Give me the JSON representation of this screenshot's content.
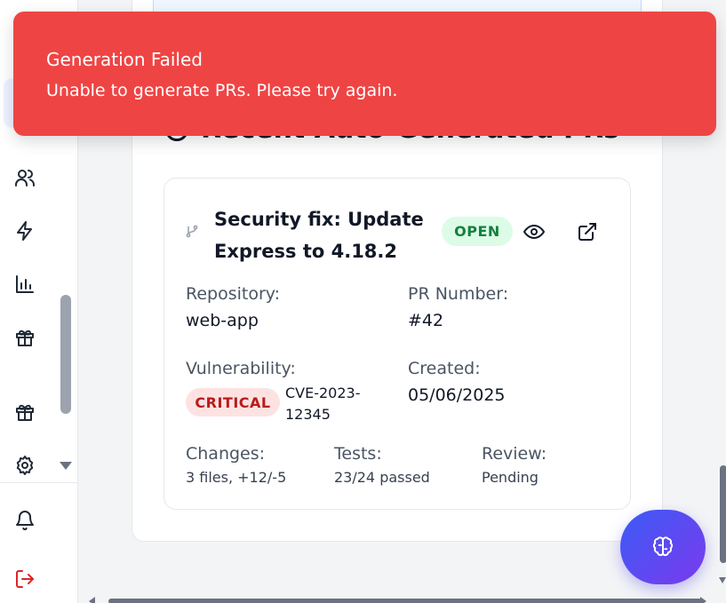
{
  "toast": {
    "title": "Generation Failed",
    "message": "Unable to generate PRs. Please try again.",
    "color": "#ef4444"
  },
  "section": {
    "title": "Recent Auto-Generated PRs",
    "icon": "clock-icon"
  },
  "pr": {
    "title": "Security fix: Update Express to 4.18.2",
    "status": "OPEN",
    "repository_label": "Repository:",
    "repository": "web-app",
    "pr_number_label": "PR Number:",
    "pr_number": "#42",
    "vulnerability_label": "Vulnerability:",
    "severity": "CRITICAL",
    "cve": "CVE-2023-12345",
    "created_label": "Created:",
    "created": "05/06/2025",
    "changes_label": "Changes:",
    "changes": "3 files, +12/-5",
    "tests_label": "Tests:",
    "tests": "23/24 passed",
    "review_label": "Review:",
    "review": "Pending",
    "icons": [
      "git-branch-icon",
      "eye-icon",
      "external-link-icon"
    ]
  },
  "sidebar": {
    "icons": [
      "users-icon",
      "lightning-icon",
      "bar-chart-icon",
      "gift-icon",
      "gift-icon",
      "gear-icon",
      "bell-icon",
      "logout-icon"
    ]
  },
  "fab": {
    "icon": "brain-icon"
  },
  "colors": {
    "open_badge_bg": "#dcfce7",
    "open_badge_text": "#15803d",
    "critical_badge_bg": "#fee2e2",
    "critical_badge_text": "#b91c1c",
    "fab_gradient_start": "#3b5bf6",
    "fab_gradient_end": "#7c3aed"
  }
}
